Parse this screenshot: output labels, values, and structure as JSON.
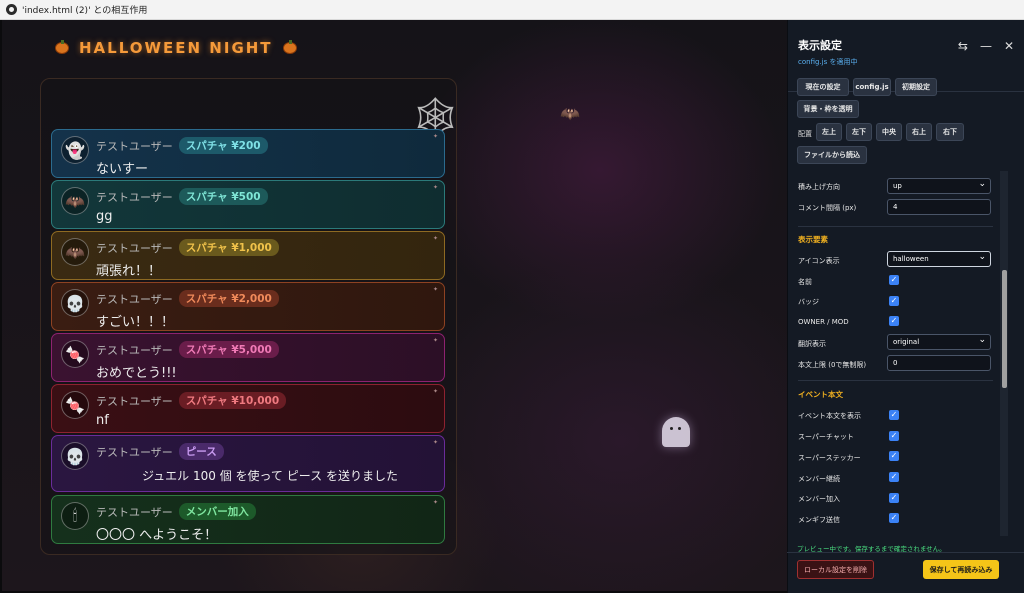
{
  "window": {
    "title": "'index.html (2)' との相互作用"
  },
  "overlay": {
    "title": "HALLOWEEN NIGHT",
    "messages": [
      {
        "name": "テストユーザー",
        "badge": "スパチャ ¥200",
        "text": "ないすー",
        "icon": "ghost-icon"
      },
      {
        "name": "テストユーザー",
        "badge": "スパチャ ¥500",
        "text": "gg",
        "icon": "bat-icon"
      },
      {
        "name": "テストユーザー",
        "badge": "スパチャ ¥1,000",
        "text": "頑張れ！！",
        "icon": "bat-icon"
      },
      {
        "name": "テストユーザー",
        "badge": "スパチャ ¥2,000",
        "text": "すごい！！！",
        "icon": "skull-icon"
      },
      {
        "name": "テストユーザー",
        "badge": "スパチャ ¥5,000",
        "text": "おめでとう!!!",
        "icon": "candy-icon"
      },
      {
        "name": "テストユーザー",
        "badge": "スパチャ ¥10,000",
        "text": "nf",
        "icon": "candy-icon"
      },
      {
        "name": "テストユーザー",
        "badge": "ピース",
        "text": "ジュエル 100 個 を使って ピース を送りました",
        "icon": "skull-icon"
      },
      {
        "name": "テストユーザー",
        "badge": "メンバー加入",
        "text": "〇〇〇 へようこそ！",
        "icon": "candle-icon"
      }
    ]
  },
  "settings": {
    "title": "表示設定",
    "subtitle": "config.js を適用中",
    "buttons": {
      "current": "現在の設定",
      "config": "config.js",
      "initial": "初期設定",
      "transparent": "背景・枠を透明",
      "load_file": "ファイルから読込"
    },
    "position_label": "配置",
    "positions": [
      "左上",
      "左下",
      "中央",
      "右上",
      "右下"
    ],
    "stack_label": "積み上げ方向",
    "stack_value": "up",
    "gap_label": "コメント間隔 (px)",
    "gap_value": "4",
    "section_display": "表示要素",
    "icon_label": "アイコン表示",
    "icon_value": "halloween",
    "name_label": "名前",
    "badge_label": "バッジ",
    "owner_label": "OWNER / MOD",
    "translate_label": "翻訳表示",
    "translate_value": "original",
    "limit_label": "本文上限 (0で無制限)",
    "limit_value": "0",
    "section_event": "イベント本文",
    "event_items": [
      "イベント本文を表示",
      "スーパーチャット",
      "スーパーステッカー",
      "メンバー継続",
      "メンバー加入",
      "メンギフ送信"
    ],
    "preview_note": "プレビュー中です。保存するまで確定されません。",
    "reset_button": "ローカル設定を削除",
    "save_button": "保存して再読み込み"
  },
  "colors": {
    "accent": "#f5c518",
    "check": "#3b82f6",
    "section": "#f0b020",
    "title": "#f59a3a"
  }
}
